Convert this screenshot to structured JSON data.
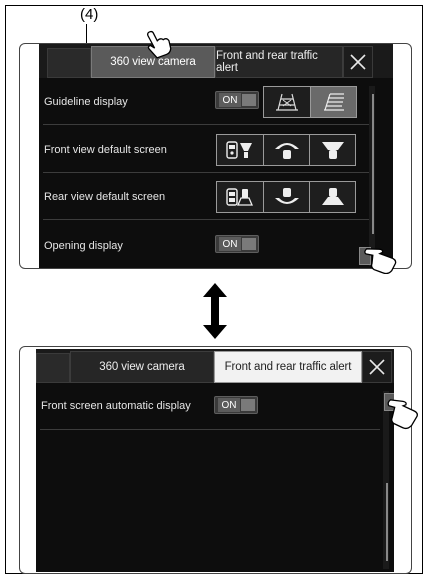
{
  "callout_label": "(4)",
  "top_screen": {
    "tabs": [
      "360 view camera",
      "Front and rear traffic alert"
    ],
    "active_tab_index": 0,
    "rows": [
      {
        "label": "Guideline display",
        "toggle": "ON",
        "options_icons": [
          "guideline-perspective-icon",
          "guideline-flat-icon"
        ],
        "selected_option": 1
      },
      {
        "label": "Front view default screen",
        "options_icons": [
          "front-split-view-icon",
          "front-top-view-icon",
          "front-wide-view-icon"
        ]
      },
      {
        "label": "Rear view default screen",
        "options_icons": [
          "rear-split-view-icon",
          "rear-top-view-icon",
          "rear-wide-view-icon"
        ]
      },
      {
        "label": "Opening display",
        "toggle": "ON"
      }
    ]
  },
  "bottom_screen": {
    "tabs": [
      "360 view camera",
      "Front and rear traffic alert"
    ],
    "active_tab_index": 1,
    "rows": [
      {
        "label": "Front screen automatic display",
        "toggle": "ON"
      }
    ]
  },
  "colors": {
    "screen_bg": "#0d0d0d",
    "active_tab_top": "#5a5a5a",
    "active_tab_bottom": "#f2f2f2"
  }
}
